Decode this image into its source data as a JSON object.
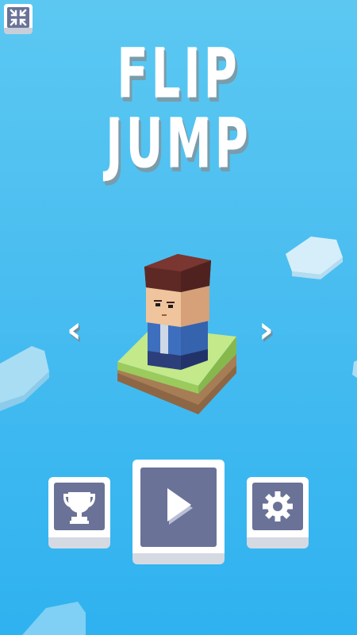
{
  "game": {
    "title_line1": "FLIP",
    "title_line2": "JUMP",
    "prev_arrow": "‹",
    "next_arrow": "›"
  },
  "buttons": {
    "minimize": "compress-icon",
    "leaderboard": "trophy-icon",
    "play": "play-icon",
    "settings": "gear-icon"
  },
  "colors": {
    "sky_top": "#5cc8f2",
    "sky_bottom": "#2fb2f0",
    "button_face": "#ffffff",
    "button_inner": "#6a7297",
    "grass": "#b5e07a",
    "dirt": "#a07a53",
    "hair": "#6b2f2a",
    "skin": "#f0c49c",
    "jacket": "#3e6fbe"
  }
}
